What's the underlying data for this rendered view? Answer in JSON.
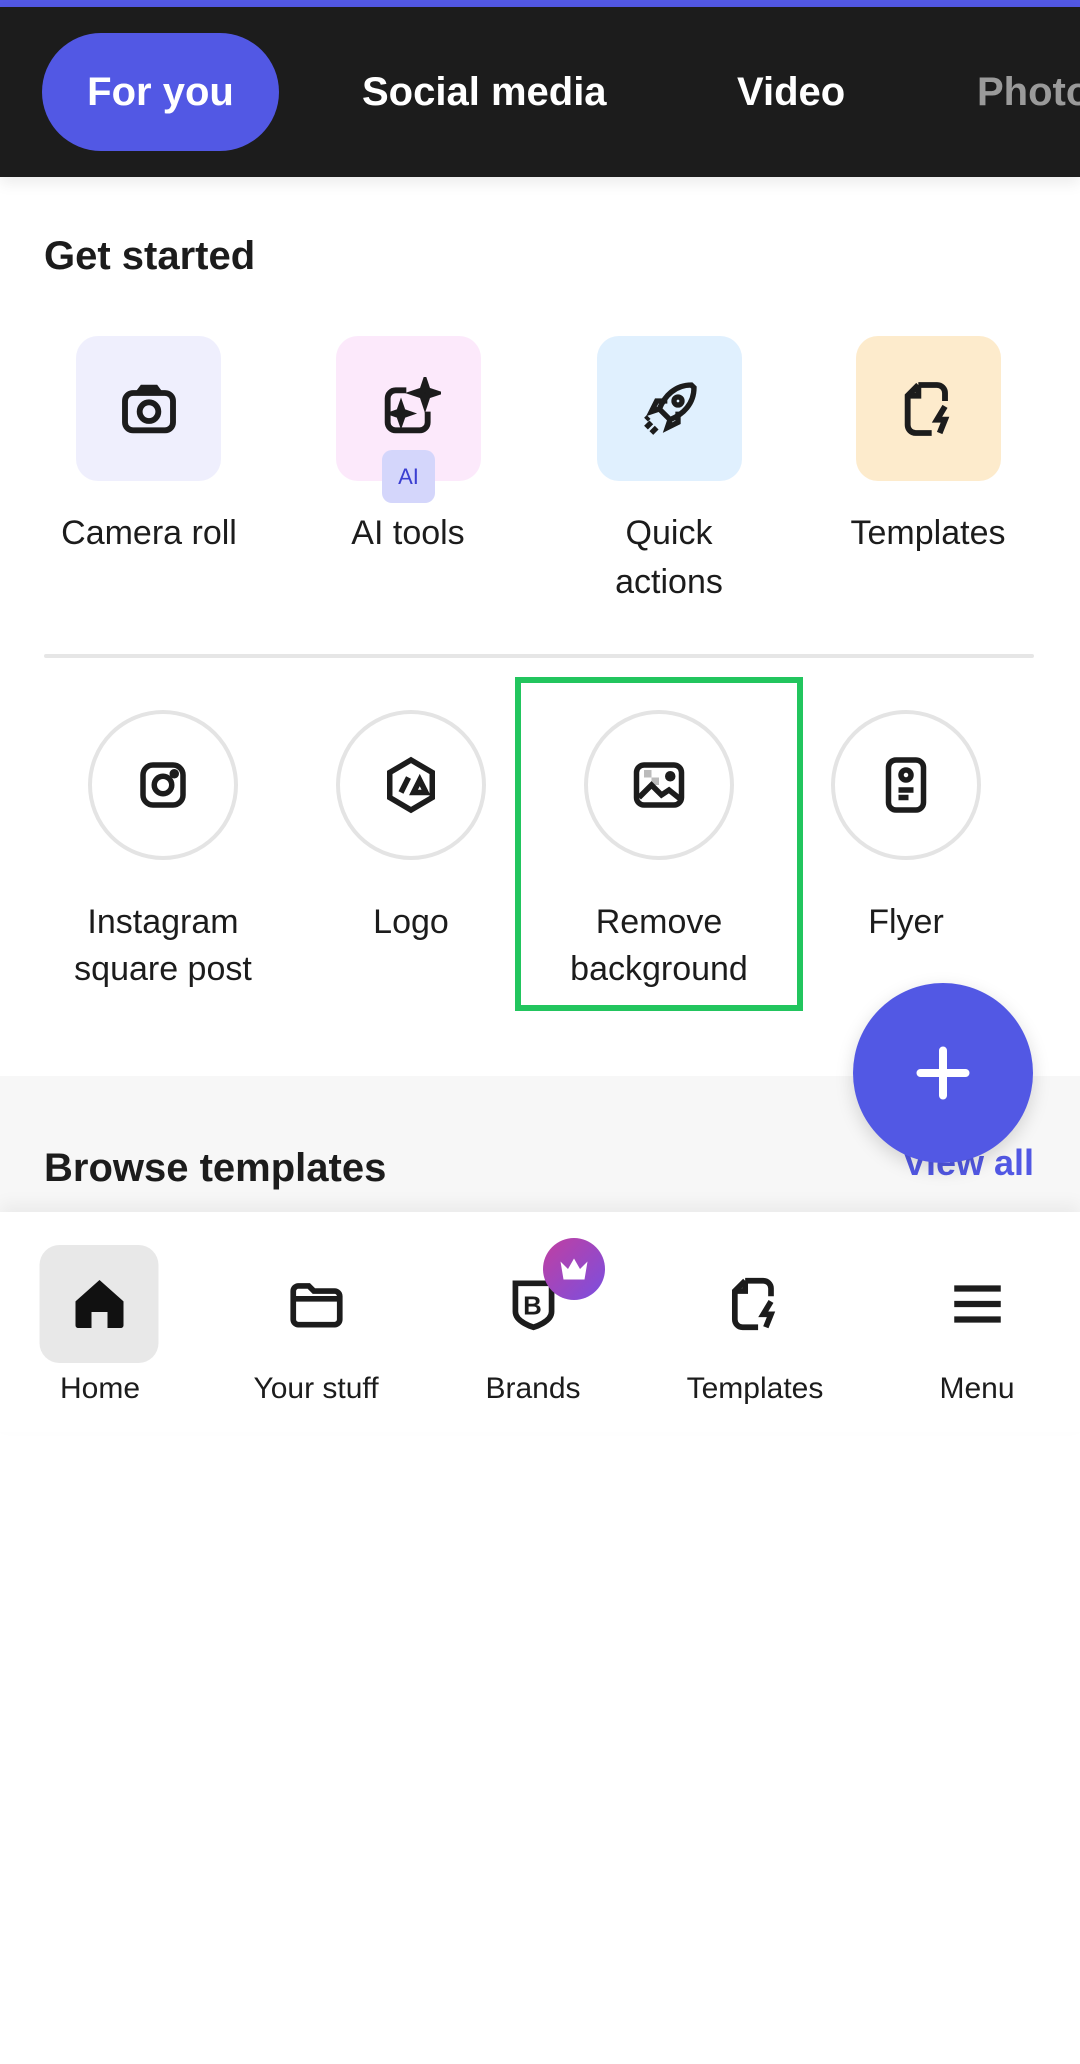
{
  "colors": {
    "accent": "#5258e4",
    "header_bg": "#1c1c1c",
    "highlight": "#22c55e"
  },
  "tabs": [
    {
      "label": "For you",
      "active": true
    },
    {
      "label": "Social media"
    },
    {
      "label": "Video"
    },
    {
      "label": "Photo"
    }
  ],
  "get_started": {
    "title": "Get started",
    "tiles": [
      {
        "label": "Camera roll",
        "icon": "camera-icon",
        "bg": "#efeffd"
      },
      {
        "label": "AI tools",
        "icon": "sparkle-icon",
        "bg": "#fce9fb",
        "badge": "AI"
      },
      {
        "label": "Quick",
        "label2": "actions",
        "icon": "rocket-icon",
        "bg": "#e0f0fe"
      },
      {
        "label": "Templates",
        "icon": "template-icon",
        "bg": "#fdebcc"
      }
    ]
  },
  "quick": [
    {
      "label": "Instagram",
      "label2": "square post",
      "icon": "instagram-icon"
    },
    {
      "label": "Logo",
      "icon": "logo-icon"
    },
    {
      "label": "Remove",
      "label2": "background",
      "icon": "remove-background-icon"
    },
    {
      "label": "Flyer",
      "icon": "flyer-icon"
    }
  ],
  "browse": {
    "title": "Browse templates",
    "view_all": "View all"
  },
  "nav": [
    {
      "label": "Home",
      "active": true
    },
    {
      "label": "Your stuff"
    },
    {
      "label": "Brands"
    },
    {
      "label": "Templates"
    },
    {
      "label": "Menu"
    }
  ]
}
